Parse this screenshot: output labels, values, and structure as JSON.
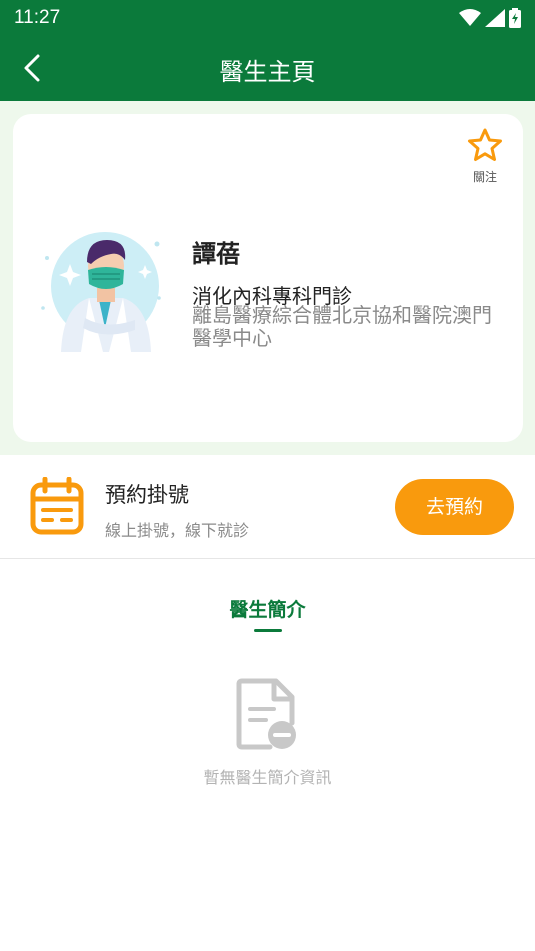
{
  "status_bar": {
    "time": "11:27"
  },
  "app_bar": {
    "title": "醫生主頁"
  },
  "doctor": {
    "follow_label": "關注",
    "name": "譚蓓",
    "department": "消化內科專科門診",
    "hospital": "離島醫療綜合體北京協和醫院澳門醫學中心"
  },
  "appointment": {
    "title": "預約掛號",
    "subtitle": "線上掛號，線下就診",
    "button_label": "去預約"
  },
  "intro": {
    "tab_label": "醫生簡介",
    "empty_text": "暫無醫生簡介資訊"
  },
  "colors": {
    "brand": "#0b7a3b",
    "accent": "#f99a0d",
    "hero_bg": "#eef8ec"
  }
}
